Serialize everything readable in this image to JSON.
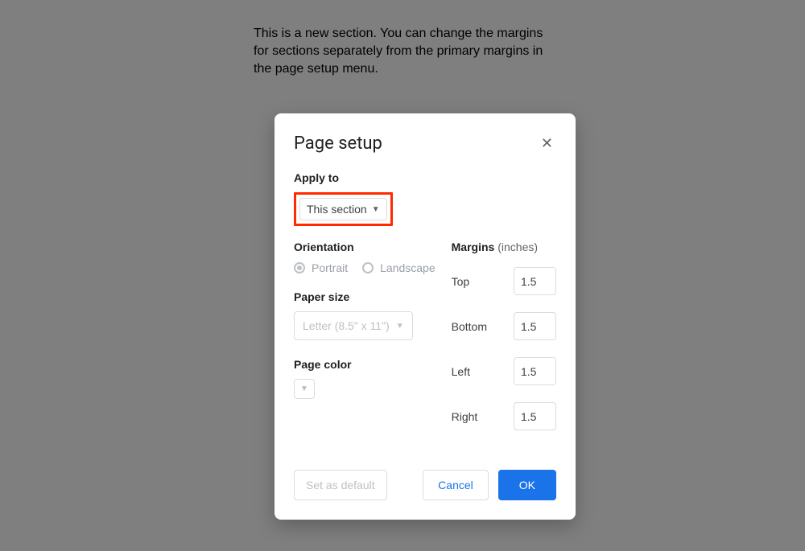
{
  "document_text": "This is a new section. You can change the margins for sections separately from the primary margins in the page setup menu.",
  "dialog": {
    "title": "Page setup",
    "apply_to": {
      "label": "Apply to",
      "selected": "This section"
    },
    "orientation": {
      "label": "Orientation",
      "portrait": "Portrait",
      "landscape": "Landscape"
    },
    "paper_size": {
      "label": "Paper size",
      "value": "Letter (8.5\" x 11\")"
    },
    "page_color": {
      "label": "Page color"
    },
    "margins": {
      "label": "Margins",
      "unit": "(inches)",
      "top_label": "Top",
      "top_value": "1.5",
      "bottom_label": "Bottom",
      "bottom_value": "1.5",
      "left_label": "Left",
      "left_value": "1.5",
      "right_label": "Right",
      "right_value": "1.5"
    },
    "actions": {
      "set_as_default": "Set as default",
      "cancel": "Cancel",
      "ok": "OK"
    }
  }
}
